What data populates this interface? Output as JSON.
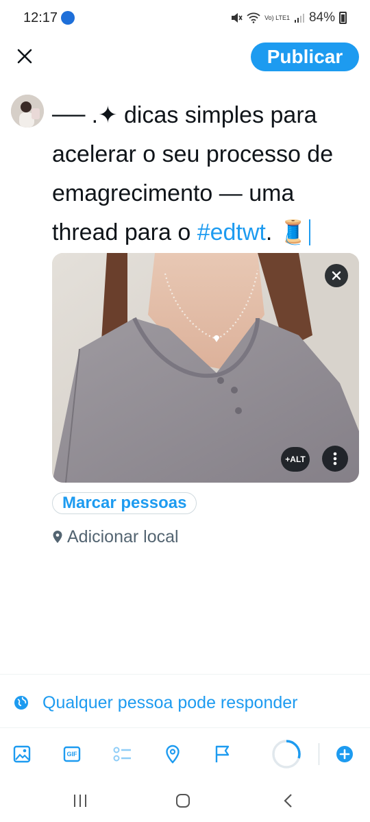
{
  "status_bar": {
    "time": "12:17",
    "network_label": "Vo) LTE1",
    "battery_percent": "84%"
  },
  "header": {
    "close_icon": "close-icon",
    "publish_label": "Publicar"
  },
  "composer": {
    "text_before": "── .✦  dicas simples para acelerar o seu processo de emagrecimento — uma thread para o ",
    "hashtag": "#edtwt",
    "text_after": ". 🧵"
  },
  "media": {
    "alt_label": "+ALT",
    "remove_icon": "close-icon",
    "more_icon": "more-vertical-icon"
  },
  "tag_people_label": "Marcar pessoas",
  "location_label": "Adicionar local",
  "reply_setting_label": "Qualquer pessoa pode responder",
  "toolbar": {
    "items": [
      "image-icon",
      "gif-icon",
      "poll-icon",
      "location-icon",
      "flag-icon",
      "progress-ring-icon",
      "add-icon"
    ],
    "gif_label": "GIF",
    "progress": 0.3
  },
  "nav": {
    "items": [
      "recent-apps-icon",
      "home-icon",
      "back-icon"
    ]
  },
  "colors": {
    "accent": "#1d9bf0",
    "text": "#0f1419",
    "secondary_text": "#536471"
  }
}
